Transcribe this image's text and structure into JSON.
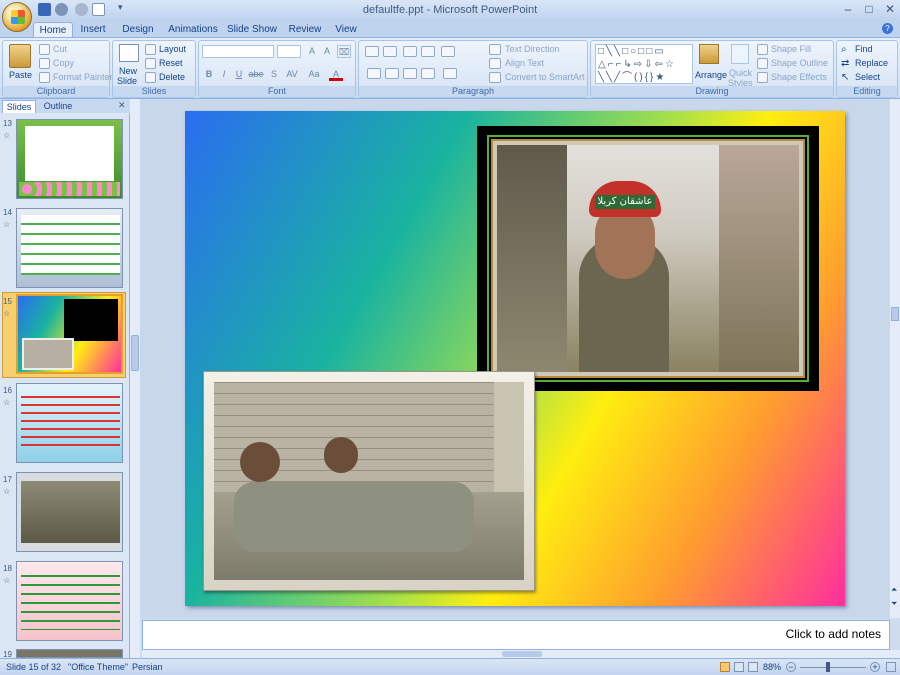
{
  "app": {
    "title": "defaultfe.ppt - Microsoft PowerPoint",
    "window_controls": {
      "minimize": "–",
      "maximize": "□",
      "close": "✕"
    }
  },
  "tabs": [
    "Home",
    "Insert",
    "Design",
    "Animations",
    "Slide Show",
    "Review",
    "View"
  ],
  "active_tab": "Home",
  "ribbon": {
    "clipboard": {
      "label": "Clipboard",
      "paste": "Paste",
      "cut": "Cut",
      "copy": "Copy",
      "format_painter": "Format Painter"
    },
    "slides": {
      "label": "Slides",
      "new_slide": "New",
      "new_slide2": "Slide",
      "layout": "Layout",
      "reset": "Reset",
      "delete": "Delete"
    },
    "font": {
      "label": "Font",
      "bold": "B",
      "italic": "I",
      "underline": "U",
      "strike": "abe",
      "shadow": "S",
      "spacing": "AV",
      "case": "Aa",
      "color": "A",
      "grow": "A",
      "shrink": "A"
    },
    "paragraph": {
      "label": "Paragraph",
      "text_direction": "Text Direction",
      "align_text": "Align Text",
      "convert_smartart": "Convert to SmartArt"
    },
    "drawing": {
      "label": "Drawing",
      "arrange": "Arrange",
      "quick_styles": "Quick",
      "quick_styles2": "Styles",
      "shape_fill": "Shape Fill",
      "shape_outline": "Shape Outline",
      "shape_effects": "Shape Effects"
    },
    "editing": {
      "label": "Editing",
      "find": "Find",
      "replace": "Replace",
      "select": "Select"
    }
  },
  "pane": {
    "tab_slides": "Slides",
    "tab_outline": "Outline",
    "close": "✕",
    "thumbnails": [
      {
        "number": "13",
        "star": "☆"
      },
      {
        "number": "14",
        "star": "☆"
      },
      {
        "number": "15",
        "star": "☆"
      },
      {
        "number": "16",
        "star": "☆"
      },
      {
        "number": "17",
        "star": "☆"
      },
      {
        "number": "18",
        "star": "☆"
      },
      {
        "number": "19",
        "star": ""
      }
    ]
  },
  "slide": {
    "helmet_text": "عاشقان کربلا"
  },
  "notes_placeholder": "Click to add notes",
  "status": {
    "slide_info": "Slide 15 of 32",
    "theme": "\"Office Theme\"",
    "language": "Persian",
    "zoom": "88%"
  }
}
